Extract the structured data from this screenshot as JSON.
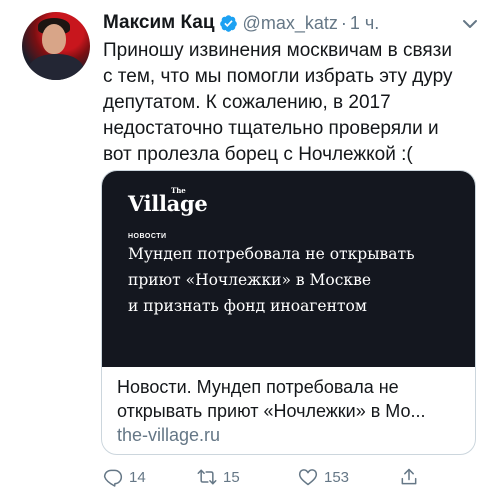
{
  "tweet": {
    "author_name": "Максим Кац",
    "handle": "@max_katz",
    "separator": "·",
    "time": "1 ч.",
    "text": "Приношу извинения москвичам в связи\nс тем, что мы помогли избрать эту дуру\nдепутатом. К сожалению, в 2017\nнедостаточно тщательно проверяли и\nвот пролезла борец с Ночлежкой :("
  },
  "card": {
    "image": {
      "logo_the": "The",
      "logo": "Village",
      "section_tag": "НОВОСТИ",
      "headline": "Мундеп потребовала не открывать\nприют «Ночлежки» в Москве\nи признать фонд иноагентом"
    },
    "title_line1": "Новости. Мундеп потребовала не",
    "title_line2": "открывать приют «Ночлежки» в Мо...",
    "domain": "the-village.ru"
  },
  "actions": {
    "replies": "14",
    "retweets": "15",
    "likes": "153"
  },
  "colors": {
    "text": "#14171a",
    "secondary": "#657786",
    "verified": "#1da1f2",
    "card_border": "#ccd6dd",
    "card_image_bg": "#14171f"
  },
  "icons": {
    "verified": "verified-badge-icon",
    "more": "chevron-down-icon",
    "reply": "reply-icon",
    "retweet": "retweet-icon",
    "like": "heart-icon",
    "share": "share-icon"
  }
}
